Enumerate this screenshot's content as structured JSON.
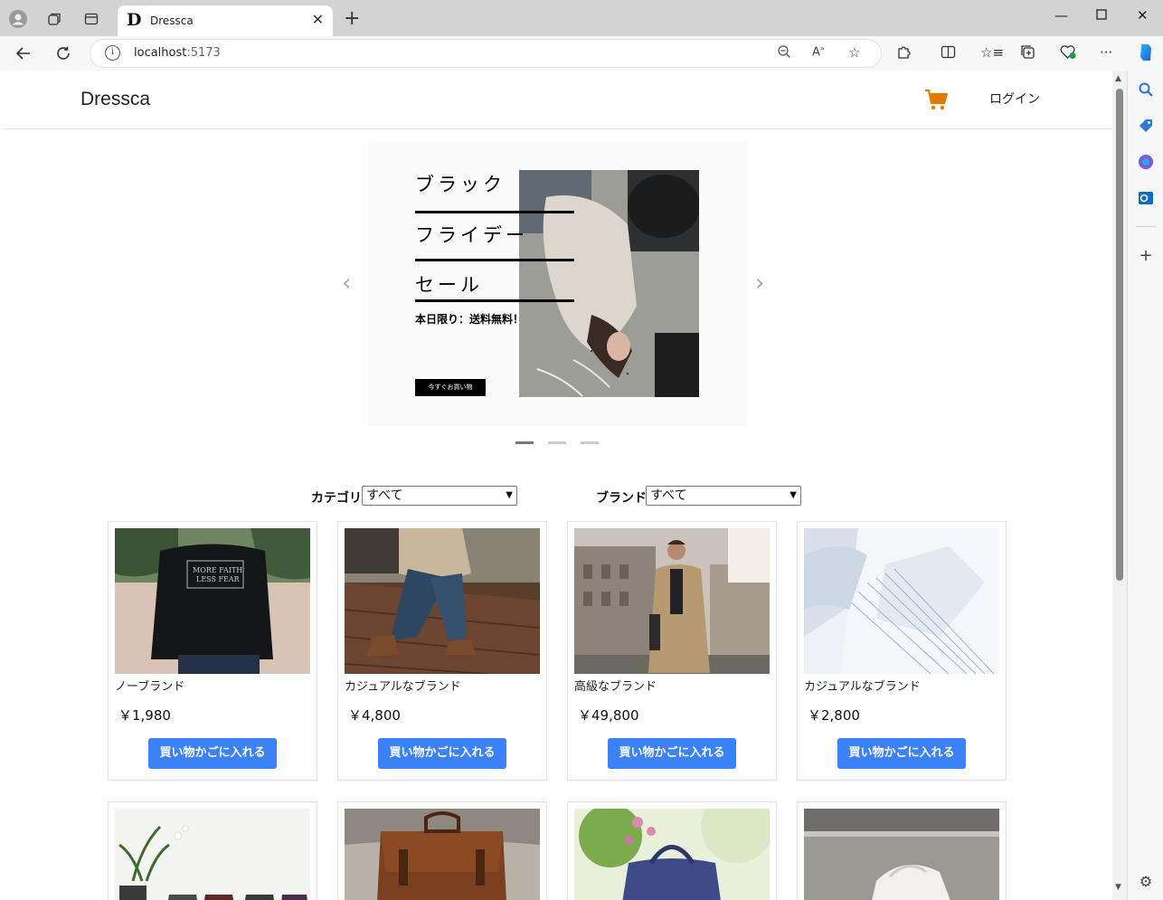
{
  "browser": {
    "tab_title": "Dressca",
    "tab_favicon": "D",
    "url_host": "localhost",
    "url_port": ":5173"
  },
  "header": {
    "brand": "Dressca",
    "login": "ログイン"
  },
  "carousel": {
    "headline_1": "ブラック",
    "headline_2": "フライデー",
    "headline_3": "セール",
    "subtitle": "本日限り：送料無料！",
    "shop_button": "今すぐお買い物"
  },
  "filters": {
    "category_label": "カテゴリ",
    "category_value": "すべて",
    "brand_label": "ブランド",
    "brand_value": "すべて"
  },
  "products": [
    {
      "brand": "ノーブランド",
      "price": "￥1,980",
      "button": "買い物かごに入れる"
    },
    {
      "brand": "カジュアルなブランド",
      "price": "￥4,800",
      "button": "買い物かごに入れる"
    },
    {
      "brand": "高級なブランド",
      "price": "￥49,800",
      "button": "買い物かごに入れる"
    },
    {
      "brand": "カジュアルなブランド",
      "price": "￥2,800",
      "button": "買い物かごに入れる"
    }
  ],
  "colors": {
    "accent": "#3b82f6",
    "cart": "#e07b00"
  }
}
